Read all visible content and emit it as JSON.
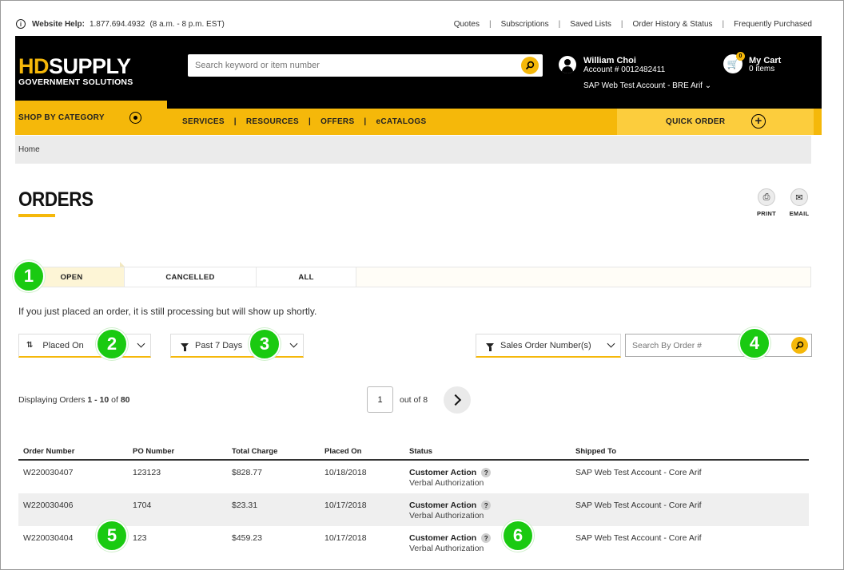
{
  "help": {
    "label": "Website Help:",
    "phone": "1.877.694.4932",
    "hours": "(8 a.m. - 8 p.m. EST)"
  },
  "top_links": [
    "Quotes",
    "Subscriptions",
    "Saved Lists",
    "Order History & Status",
    "Frequently Purchased"
  ],
  "logo": {
    "brand_a": "HD",
    "brand_b": "SUPPLY",
    "sub": "GOVERNMENT SOLUTIONS"
  },
  "search": {
    "placeholder": "Search keyword or item number"
  },
  "account": {
    "name": "William Choi",
    "number": "Account # 0012482411",
    "selected": "SAP Web Test Account - BRE Arif"
  },
  "cart": {
    "title": "My Cart",
    "items": "0 items",
    "badge": "0"
  },
  "nav": {
    "shop": "SHOP BY CATEGORY",
    "menu": [
      "SERVICES",
      "RESOURCES",
      "OFFERS",
      "eCATALOGS"
    ],
    "quick": "QUICK ORDER"
  },
  "breadcrumb": "Home",
  "page": {
    "title": "ORDERS",
    "print": "PRINT",
    "email": "EMAIL"
  },
  "tabs": [
    "OPEN",
    "CANCELLED",
    "ALL"
  ],
  "notice": "If you just placed an order, it is still processing but will show up shortly.",
  "filters": {
    "sort": "Placed On",
    "date": "Past 7 Days",
    "field": "Sales Order Number(s)",
    "order_search_placeholder": "Search By Order #"
  },
  "pagination": {
    "prefix": "Displaying Orders ",
    "range": "1 - 10",
    "mid": " of ",
    "total": "80",
    "page": "1",
    "out_of": "out of 8"
  },
  "table": {
    "headers": [
      "Order Number",
      "PO Number",
      "Total Charge",
      "Placed On",
      "Status",
      "Shipped To"
    ],
    "rows": [
      {
        "order": "W220030407",
        "po": "123123",
        "charge": "$828.77",
        "placed": "10/18/2018",
        "status": "Customer Action",
        "status_sub": "Verbal Authorization",
        "ship": "SAP Web Test Account - Core Arif"
      },
      {
        "order": "W220030406",
        "po": "1704",
        "charge": "$23.31",
        "placed": "10/17/2018",
        "status": "Customer Action",
        "status_sub": "Verbal Authorization",
        "ship": "SAP Web Test Account - Core Arif"
      },
      {
        "order": "W220030404",
        "po": "123",
        "charge": "$459.23",
        "placed": "10/17/2018",
        "status": "Customer Action",
        "status_sub": "Verbal Authorization",
        "ship": "SAP Web Test Account - Core Arif"
      }
    ]
  },
  "callouts": [
    "1",
    "2",
    "3",
    "4",
    "5",
    "6"
  ],
  "colors": {
    "accent": "#f5b80a",
    "callout": "#1aca11",
    "header_bg": "#000000"
  }
}
